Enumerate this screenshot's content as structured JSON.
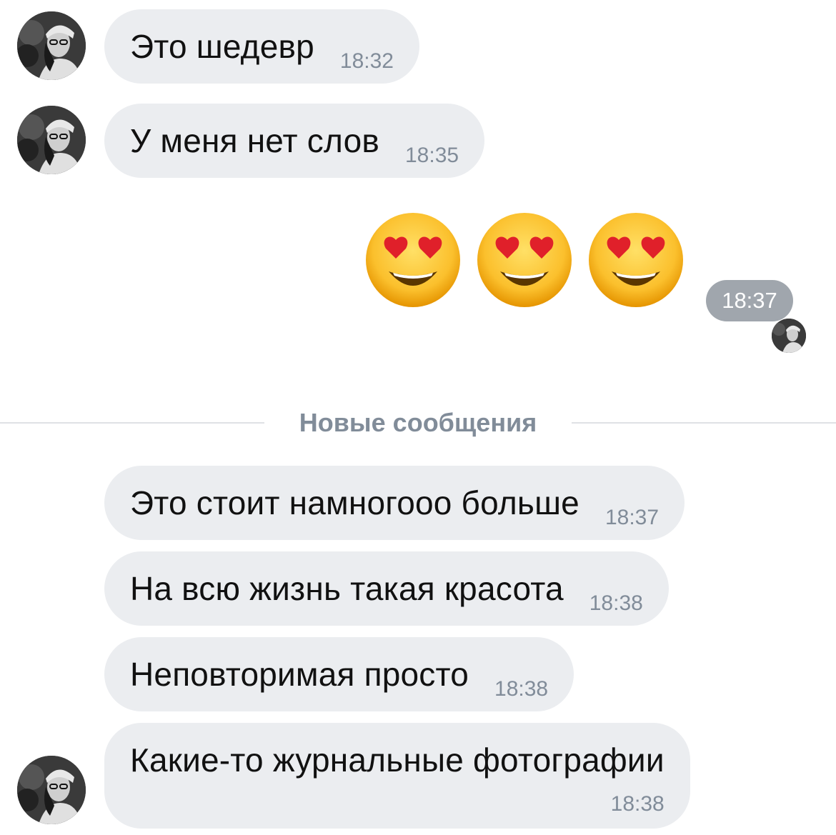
{
  "messages_top": [
    {
      "text": "Это шедевр",
      "time": "18:32"
    },
    {
      "text": "У меня нет слов",
      "time": "18:35"
    }
  ],
  "outgoing": {
    "emojis": [
      "heart-eyes-emoji",
      "heart-eyes-emoji",
      "heart-eyes-emoji"
    ],
    "time": "18:37"
  },
  "divider": {
    "label": "Новые сообщения"
  },
  "messages_new": [
    {
      "text": "Это стоит намногооо больше",
      "time": "18:37"
    },
    {
      "text": "На всю жизнь такая красота",
      "time": "18:38"
    },
    {
      "text": "Неповторимая просто",
      "time": "18:38"
    },
    {
      "text": "Какие-то журнальные фотографии",
      "time": "18:38"
    }
  ],
  "colors": {
    "bubble_bg": "#ebedf0",
    "time_text": "#818c99",
    "time_pill_bg": "#a0a6ad",
    "divider_line": "#dfe1e5"
  }
}
